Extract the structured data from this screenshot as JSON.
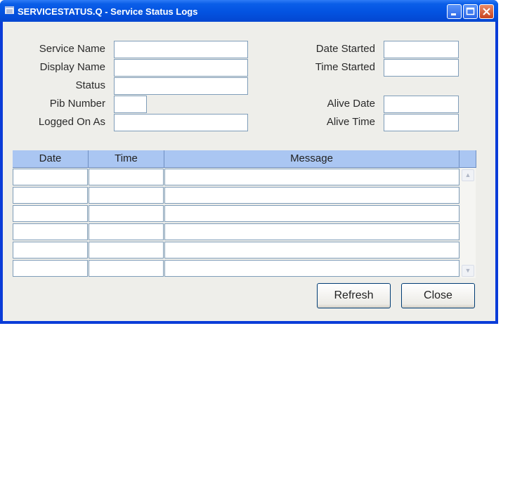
{
  "window": {
    "title": "SERVICESTATUS.Q - Service Status Logs",
    "icon": "app-window-icon",
    "controls": [
      "minimize-icon",
      "maximize-icon",
      "close-icon"
    ]
  },
  "form": {
    "service_name_label": "Service Name",
    "display_name_label": "Display Name",
    "status_label": "Status",
    "pib_number_label": "Pib Number",
    "logged_on_as_label": "Logged On As",
    "date_started_label": "Date Started",
    "time_started_label": "Time Started",
    "alive_date_label": "Alive Date",
    "alive_time_label": "Alive Time",
    "values": {
      "service_name": "",
      "display_name": "",
      "status": "",
      "pib_number": "",
      "logged_on_as": "",
      "date_started": "",
      "time_started": "",
      "alive_date": "",
      "alive_time": ""
    }
  },
  "grid": {
    "columns": [
      "Date",
      "Time",
      "Message"
    ],
    "rows": [
      [
        "",
        "",
        ""
      ],
      [
        "",
        "",
        ""
      ],
      [
        "",
        "",
        ""
      ],
      [
        "",
        "",
        ""
      ],
      [
        "",
        "",
        ""
      ],
      [
        "",
        "",
        ""
      ]
    ]
  },
  "buttons": {
    "refresh": "Refresh",
    "close": "Close"
  },
  "colors": {
    "titlebar": "#0353e1",
    "client_bg": "#eeeeea",
    "grid_header": "#aac6f2",
    "field_border": "#7f9db9"
  }
}
